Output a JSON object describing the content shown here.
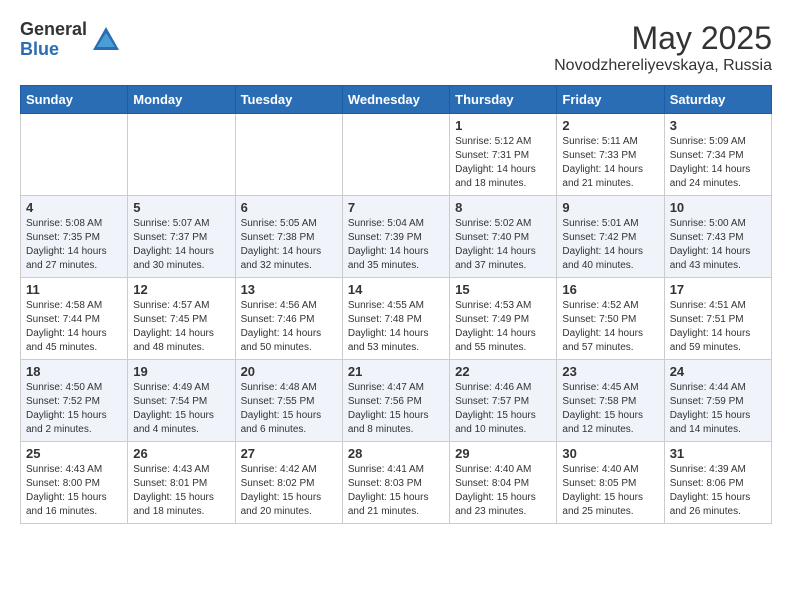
{
  "header": {
    "logo_general": "General",
    "logo_blue": "Blue",
    "month_year": "May 2025",
    "location": "Novodzhereliyevskaya, Russia"
  },
  "days_of_week": [
    "Sunday",
    "Monday",
    "Tuesday",
    "Wednesday",
    "Thursday",
    "Friday",
    "Saturday"
  ],
  "weeks": [
    {
      "days": [
        {
          "num": "",
          "info": ""
        },
        {
          "num": "",
          "info": ""
        },
        {
          "num": "",
          "info": ""
        },
        {
          "num": "",
          "info": ""
        },
        {
          "num": "1",
          "info": "Sunrise: 5:12 AM\nSunset: 7:31 PM\nDaylight: 14 hours\nand 18 minutes."
        },
        {
          "num": "2",
          "info": "Sunrise: 5:11 AM\nSunset: 7:33 PM\nDaylight: 14 hours\nand 21 minutes."
        },
        {
          "num": "3",
          "info": "Sunrise: 5:09 AM\nSunset: 7:34 PM\nDaylight: 14 hours\nand 24 minutes."
        }
      ]
    },
    {
      "days": [
        {
          "num": "4",
          "info": "Sunrise: 5:08 AM\nSunset: 7:35 PM\nDaylight: 14 hours\nand 27 minutes."
        },
        {
          "num": "5",
          "info": "Sunrise: 5:07 AM\nSunset: 7:37 PM\nDaylight: 14 hours\nand 30 minutes."
        },
        {
          "num": "6",
          "info": "Sunrise: 5:05 AM\nSunset: 7:38 PM\nDaylight: 14 hours\nand 32 minutes."
        },
        {
          "num": "7",
          "info": "Sunrise: 5:04 AM\nSunset: 7:39 PM\nDaylight: 14 hours\nand 35 minutes."
        },
        {
          "num": "8",
          "info": "Sunrise: 5:02 AM\nSunset: 7:40 PM\nDaylight: 14 hours\nand 37 minutes."
        },
        {
          "num": "9",
          "info": "Sunrise: 5:01 AM\nSunset: 7:42 PM\nDaylight: 14 hours\nand 40 minutes."
        },
        {
          "num": "10",
          "info": "Sunrise: 5:00 AM\nSunset: 7:43 PM\nDaylight: 14 hours\nand 43 minutes."
        }
      ]
    },
    {
      "days": [
        {
          "num": "11",
          "info": "Sunrise: 4:58 AM\nSunset: 7:44 PM\nDaylight: 14 hours\nand 45 minutes."
        },
        {
          "num": "12",
          "info": "Sunrise: 4:57 AM\nSunset: 7:45 PM\nDaylight: 14 hours\nand 48 minutes."
        },
        {
          "num": "13",
          "info": "Sunrise: 4:56 AM\nSunset: 7:46 PM\nDaylight: 14 hours\nand 50 minutes."
        },
        {
          "num": "14",
          "info": "Sunrise: 4:55 AM\nSunset: 7:48 PM\nDaylight: 14 hours\nand 53 minutes."
        },
        {
          "num": "15",
          "info": "Sunrise: 4:53 AM\nSunset: 7:49 PM\nDaylight: 14 hours\nand 55 minutes."
        },
        {
          "num": "16",
          "info": "Sunrise: 4:52 AM\nSunset: 7:50 PM\nDaylight: 14 hours\nand 57 minutes."
        },
        {
          "num": "17",
          "info": "Sunrise: 4:51 AM\nSunset: 7:51 PM\nDaylight: 14 hours\nand 59 minutes."
        }
      ]
    },
    {
      "days": [
        {
          "num": "18",
          "info": "Sunrise: 4:50 AM\nSunset: 7:52 PM\nDaylight: 15 hours\nand 2 minutes."
        },
        {
          "num": "19",
          "info": "Sunrise: 4:49 AM\nSunset: 7:54 PM\nDaylight: 15 hours\nand 4 minutes."
        },
        {
          "num": "20",
          "info": "Sunrise: 4:48 AM\nSunset: 7:55 PM\nDaylight: 15 hours\nand 6 minutes."
        },
        {
          "num": "21",
          "info": "Sunrise: 4:47 AM\nSunset: 7:56 PM\nDaylight: 15 hours\nand 8 minutes."
        },
        {
          "num": "22",
          "info": "Sunrise: 4:46 AM\nSunset: 7:57 PM\nDaylight: 15 hours\nand 10 minutes."
        },
        {
          "num": "23",
          "info": "Sunrise: 4:45 AM\nSunset: 7:58 PM\nDaylight: 15 hours\nand 12 minutes."
        },
        {
          "num": "24",
          "info": "Sunrise: 4:44 AM\nSunset: 7:59 PM\nDaylight: 15 hours\nand 14 minutes."
        }
      ]
    },
    {
      "days": [
        {
          "num": "25",
          "info": "Sunrise: 4:43 AM\nSunset: 8:00 PM\nDaylight: 15 hours\nand 16 minutes."
        },
        {
          "num": "26",
          "info": "Sunrise: 4:43 AM\nSunset: 8:01 PM\nDaylight: 15 hours\nand 18 minutes."
        },
        {
          "num": "27",
          "info": "Sunrise: 4:42 AM\nSunset: 8:02 PM\nDaylight: 15 hours\nand 20 minutes."
        },
        {
          "num": "28",
          "info": "Sunrise: 4:41 AM\nSunset: 8:03 PM\nDaylight: 15 hours\nand 21 minutes."
        },
        {
          "num": "29",
          "info": "Sunrise: 4:40 AM\nSunset: 8:04 PM\nDaylight: 15 hours\nand 23 minutes."
        },
        {
          "num": "30",
          "info": "Sunrise: 4:40 AM\nSunset: 8:05 PM\nDaylight: 15 hours\nand 25 minutes."
        },
        {
          "num": "31",
          "info": "Sunrise: 4:39 AM\nSunset: 8:06 PM\nDaylight: 15 hours\nand 26 minutes."
        }
      ]
    }
  ]
}
